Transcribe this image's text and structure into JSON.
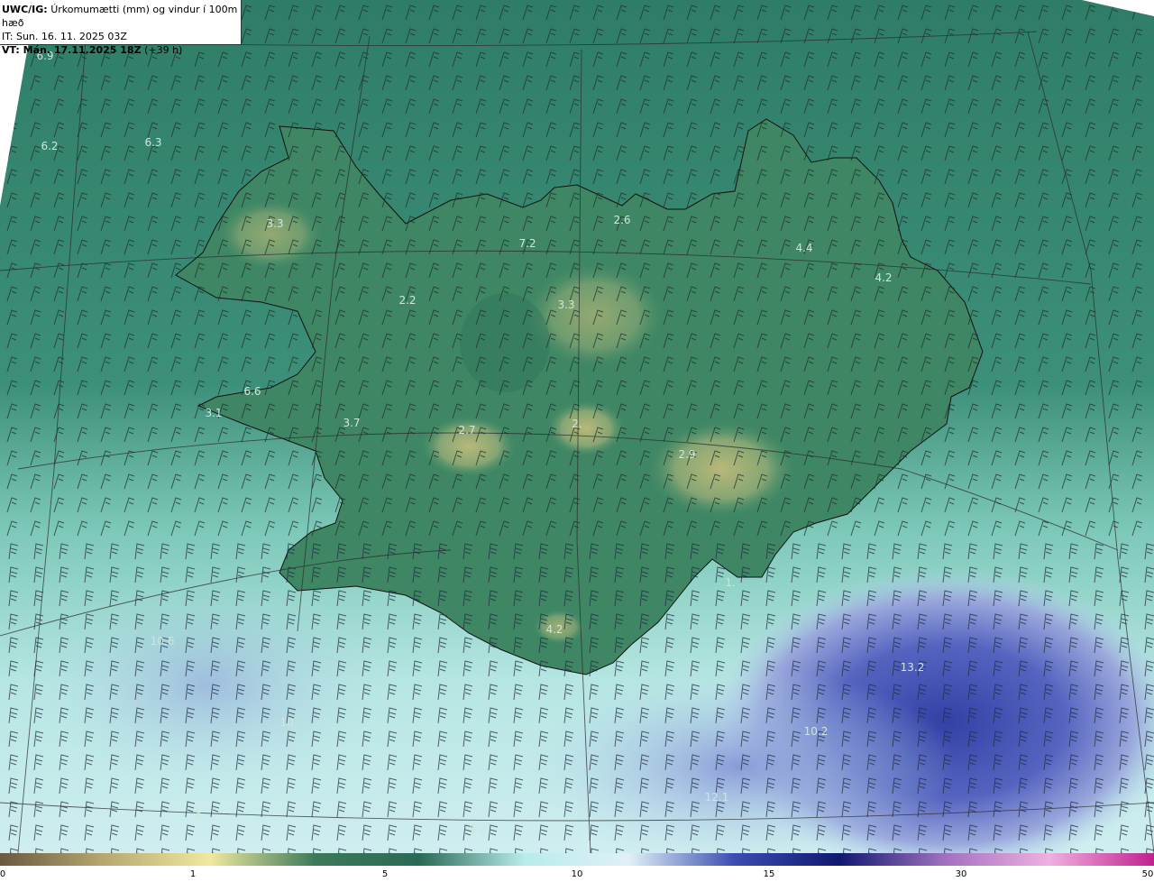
{
  "header": {
    "model": "UWC/IG:",
    "title": "Úrkomumætti (mm) og vindur í 100m hæð",
    "it_label": "IT: Sun. 16. 11. 2025 03Z",
    "vt_label": "VT: Mán. 17.11.2025 18Z",
    "vt_offset": "(+39 h)"
  },
  "labels": [
    {
      "text": "6.9",
      "cls": "land"
    },
    {
      "text": "6.2",
      "cls": "sea"
    },
    {
      "text": "6.3",
      "cls": "sea"
    },
    {
      "text": "3.3",
      "cls": "land"
    },
    {
      "text": "7.2",
      "cls": "land"
    },
    {
      "text": "2.6",
      "cls": "land"
    },
    {
      "text": "4.4",
      "cls": "land"
    },
    {
      "text": "4.2",
      "cls": "land"
    },
    {
      "text": "3.3",
      "cls": "land"
    },
    {
      "text": "2.2",
      "cls": "land"
    },
    {
      "text": "6.6",
      "cls": "land"
    },
    {
      "text": "3.1",
      "cls": "land"
    },
    {
      "text": "3.7",
      "cls": "land"
    },
    {
      "text": "2.7",
      "cls": "land"
    },
    {
      "text": "2.",
      "cls": "land"
    },
    {
      "text": "2.9",
      "cls": "land"
    },
    {
      "text": "4.2",
      "cls": "land"
    },
    {
      "text": "1.",
      "cls": "sea"
    },
    {
      "text": "13.2",
      "cls": "sea"
    },
    {
      "text": "10.2",
      "cls": "sea"
    },
    {
      "text": "12.1",
      "cls": "sea"
    },
    {
      "text": "10.6",
      "cls": "sea"
    },
    {
      "text": "10.",
      "cls": "sea"
    },
    {
      "text": "8.",
      "cls": "sea"
    },
    {
      "text": "9.2",
      "cls": "sea"
    }
  ],
  "legend": {
    "ticks": [
      "0",
      "1",
      "5",
      "10",
      "15",
      "30",
      "50"
    ],
    "colors": [
      "#6b5840",
      "#b8a870",
      "#f0e8a0",
      "#3d7a5a",
      "#2a6a55",
      "#b8ecec",
      "#e0f0f8",
      "#3b4db0",
      "#101870",
      "#a070c0",
      "#f0b0e0",
      "#c02090"
    ]
  }
}
